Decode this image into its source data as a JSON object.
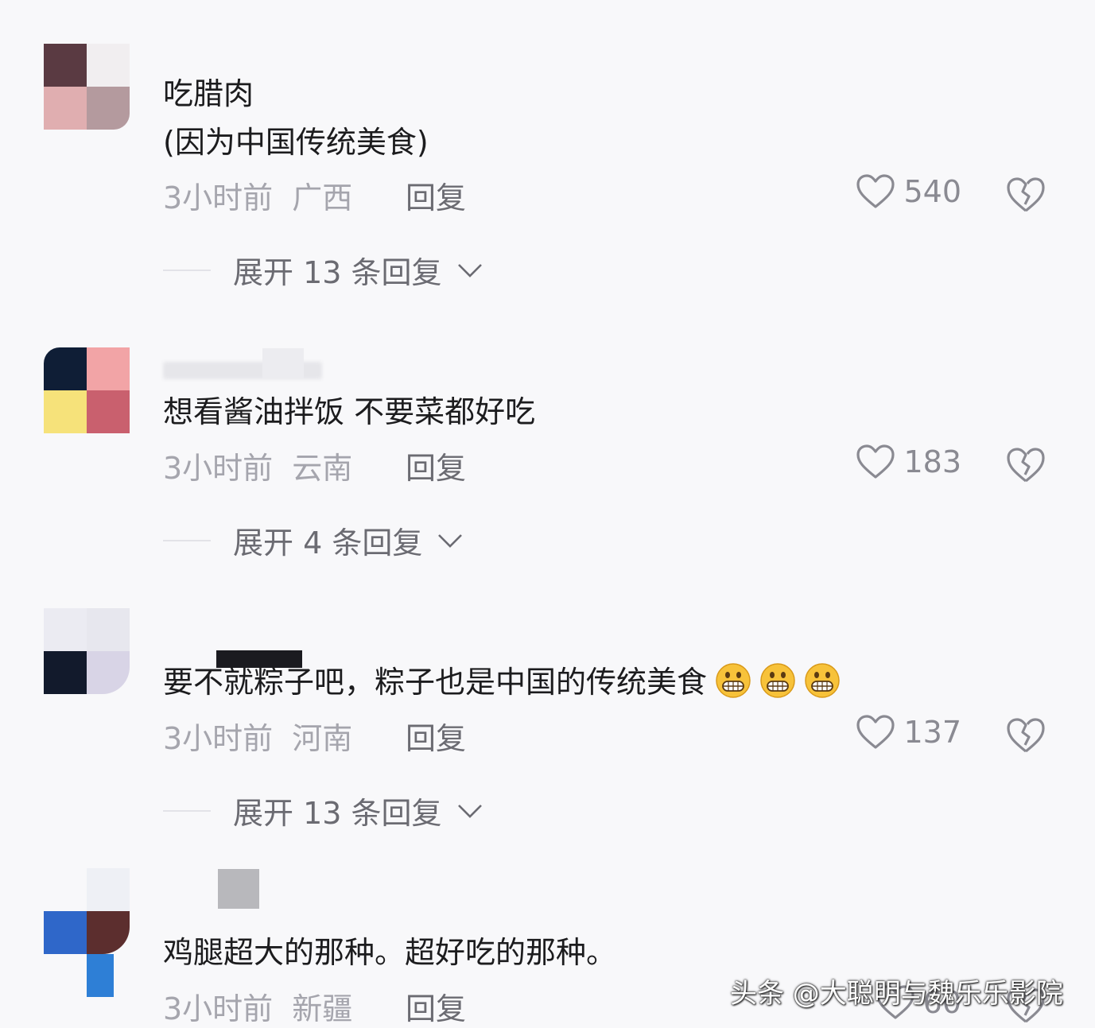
{
  "comments": [
    {
      "text_line1": "吃腊肉",
      "text_line2": "(因为中国传统美食)",
      "time": "3小时前",
      "location": "广西",
      "reply_label": "回复",
      "likes": "540",
      "expand_label": "展开 13 条回复"
    },
    {
      "text_line1": "想看酱油拌饭 不要菜都好吃",
      "time": "3小时前",
      "location": "云南",
      "reply_label": "回复",
      "likes": "183",
      "expand_label": "展开 4 条回复"
    },
    {
      "text_line1": "要不就粽子吧，粽子也是中国的传统美食",
      "emoji_count": 3,
      "emoji": "grinning-face-emoji",
      "time": "3小时前",
      "location": "河南",
      "reply_label": "回复",
      "likes": "137",
      "expand_label": "展开 13 条回复"
    },
    {
      "text_line1": "鸡腿超大的那种。超好吃的那种。",
      "time": "3小时前",
      "location": "新疆",
      "reply_label": "回复",
      "likes": "60"
    }
  ],
  "watermark": "头条 @大聪明与魏乐乐影院",
  "colors": {
    "background": "#f8f8fa",
    "text": "#1c1c1e",
    "meta": "#a5a5ad",
    "secondary": "#6b6b72"
  },
  "icons": {
    "like": "heart-outline-icon",
    "dislike": "broken-heart-icon",
    "expand": "chevron-down-icon"
  }
}
